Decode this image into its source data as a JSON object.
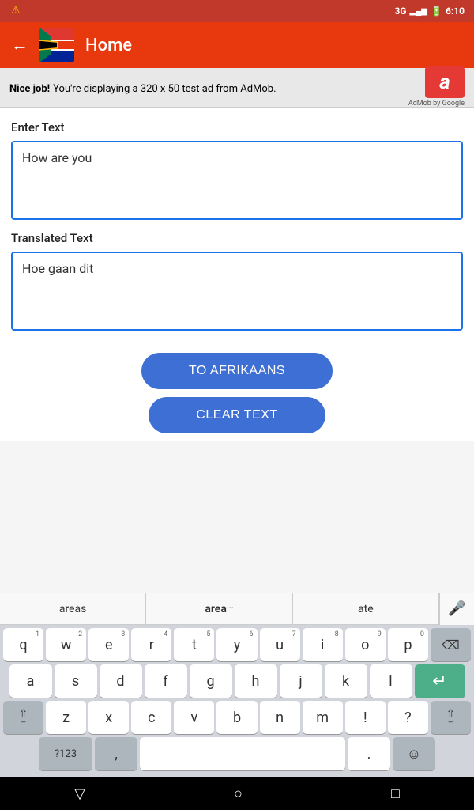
{
  "statusBar": {
    "signal": "3G",
    "time": "6:10"
  },
  "topBar": {
    "title": "Home",
    "backLabel": "←"
  },
  "adBanner": {
    "text_bold": "Nice job!",
    "text_normal": " You're displaying a 320 x 50 test ad from AdMob.",
    "logo_letter": "a",
    "by_text": "AdMob by Google"
  },
  "enterText": {
    "label": "Enter Text",
    "value": "How are you"
  },
  "translatedText": {
    "label": "Translated Text",
    "value": "Hoe gaan dit"
  },
  "buttons": {
    "translate": "TO AFRIKAANS",
    "clear": "CLEAR TEXT"
  },
  "keyboard": {
    "suggestions": [
      "areas",
      "area",
      "ate"
    ],
    "rows": [
      [
        "q",
        "w",
        "e",
        "r",
        "t",
        "y",
        "u",
        "i",
        "o",
        "p"
      ],
      [
        "a",
        "s",
        "d",
        "f",
        "g",
        "h",
        "j",
        "k",
        "l"
      ],
      [
        "↑",
        "z",
        "x",
        "c",
        "v",
        "b",
        "n",
        "m",
        "!",
        "?",
        "↑"
      ],
      [
        "?123",
        ",",
        "",
        ".",
        "."
      ]
    ],
    "numbers": [
      "1",
      "2",
      "3",
      "4",
      "5",
      "6",
      "7",
      "8",
      "9",
      "0"
    ]
  },
  "navBar": {
    "back": "▽",
    "home": "○",
    "recent": "□"
  }
}
